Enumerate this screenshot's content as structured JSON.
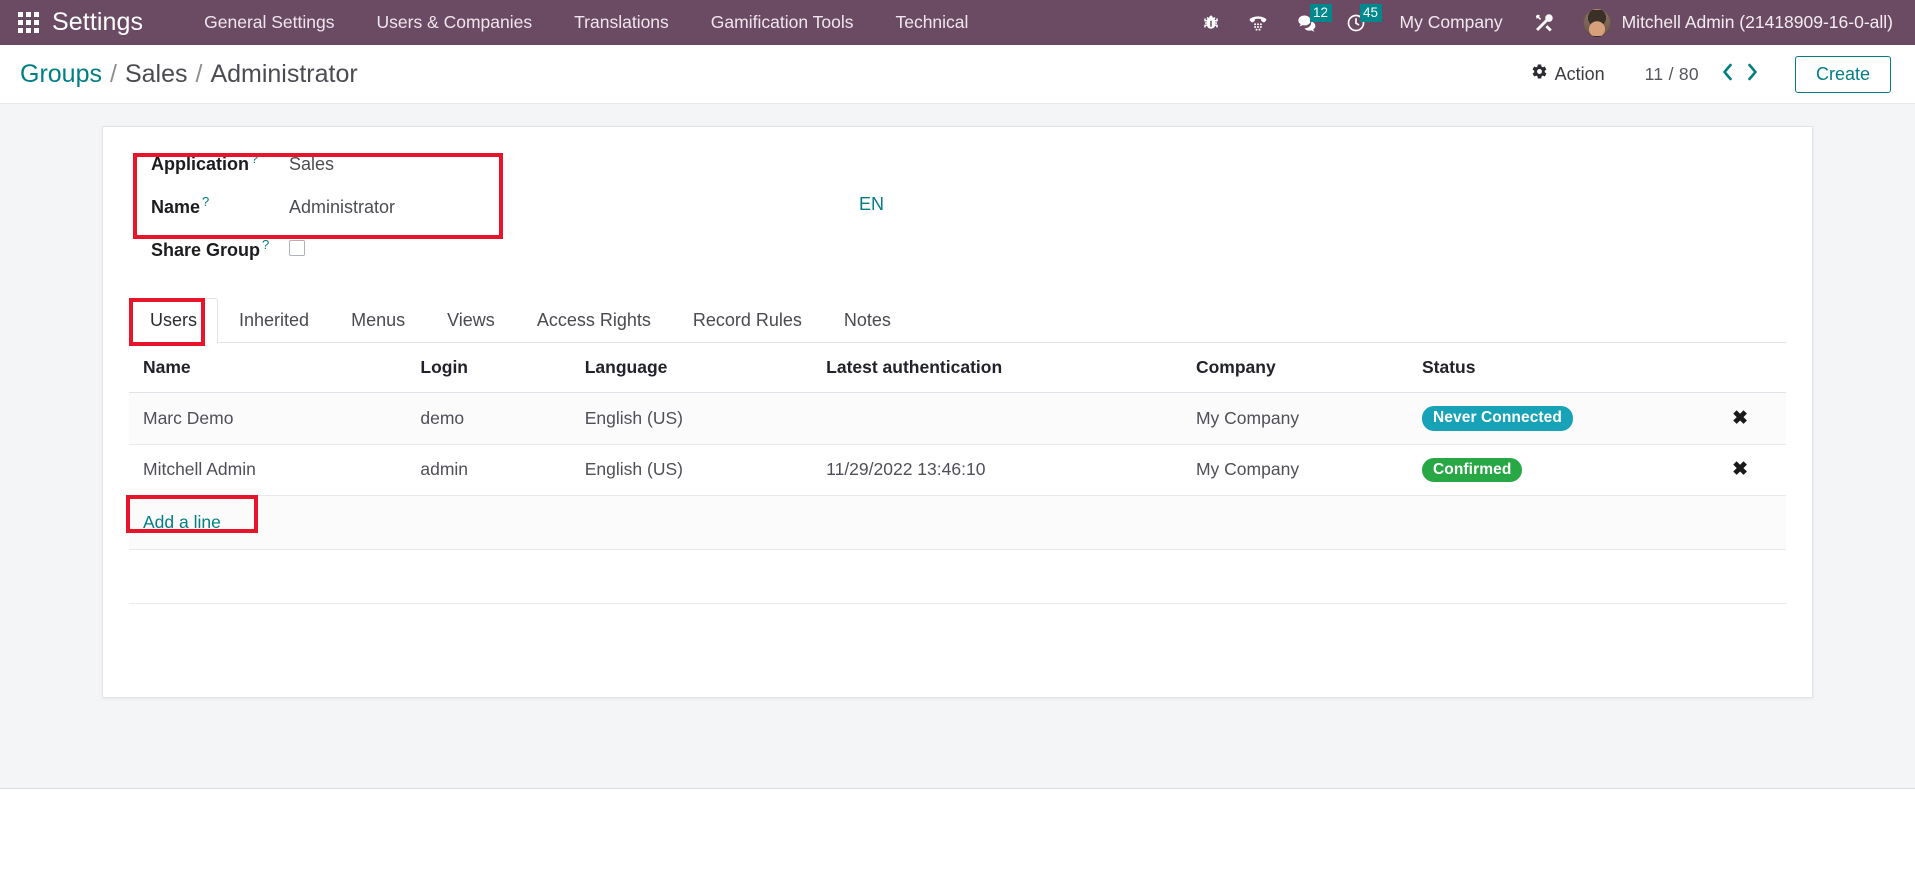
{
  "navbar": {
    "apps_icon": "apps-grid-icon",
    "brand": "Settings",
    "menus": [
      {
        "label": "General Settings"
      },
      {
        "label": "Users & Companies"
      },
      {
        "label": "Translations"
      },
      {
        "label": "Gamification Tools"
      },
      {
        "label": "Technical"
      }
    ],
    "icons": [
      {
        "name": "bug-icon",
        "badge": ""
      },
      {
        "name": "phone-dialpad-icon",
        "badge": ""
      },
      {
        "name": "messages-icon",
        "badge": "12"
      },
      {
        "name": "activities-clock-icon",
        "badge": "45"
      },
      {
        "name": "tools-icon",
        "badge": ""
      }
    ],
    "messages_badge": "12",
    "activities_badge": "45",
    "company": "My Company",
    "user": "Mitchell Admin (21418909-16-0-all)"
  },
  "control_panel": {
    "breadcrumb": {
      "root": "Groups",
      "sep1": "/",
      "level2": "Sales",
      "sep2": "/",
      "current": "Administrator"
    },
    "action_label": "Action",
    "pager": "11 / 80",
    "prev": "‹",
    "next": "›",
    "create_label": "Create"
  },
  "form": {
    "fields": [
      {
        "label": "Application",
        "tooltip": "?",
        "value": "Sales"
      },
      {
        "label": "Name",
        "tooltip": "?",
        "value": "Administrator"
      },
      {
        "label": "Share Group",
        "tooltip": "?",
        "value": ""
      }
    ],
    "application_label": "Application",
    "application_value": "Sales",
    "name_label": "Name",
    "name_value": "Administrator",
    "share_group_label": "Share Group",
    "tooltip_mark": "?",
    "language_code": "EN",
    "share_group_checked": false
  },
  "tabs": [
    {
      "label": "Users",
      "active": true
    },
    {
      "label": "Inherited",
      "active": false
    },
    {
      "label": "Menus",
      "active": false
    },
    {
      "label": "Views",
      "active": false
    },
    {
      "label": "Access Rights",
      "active": false
    },
    {
      "label": "Record Rules",
      "active": false
    },
    {
      "label": "Notes",
      "active": false
    }
  ],
  "users_table": {
    "columns": [
      "Name",
      "Login",
      "Language",
      "Latest authentication",
      "Company",
      "Status"
    ],
    "rows": [
      {
        "name": "Marc Demo",
        "login": "demo",
        "language": "English (US)",
        "latest_authentication": "",
        "company": "My Company",
        "status": "Never Connected",
        "status_kind": "info",
        "delete": "✖"
      },
      {
        "name": "Mitchell Admin",
        "login": "admin",
        "language": "English (US)",
        "latest_authentication": "11/29/2022 13:46:10",
        "company": "My Company",
        "status": "Confirmed",
        "status_kind": "ok",
        "delete": "✖"
      }
    ],
    "add_line_label": "Add a line"
  },
  "colors": {
    "navbar": "#6b4b63",
    "accent_teal": "#017e84",
    "badge_teal": "#01888c",
    "status_info": "#17a2b8",
    "status_ok": "#28a745",
    "highlight_red": "#e8152a",
    "app_background": "#f4f5f7"
  }
}
